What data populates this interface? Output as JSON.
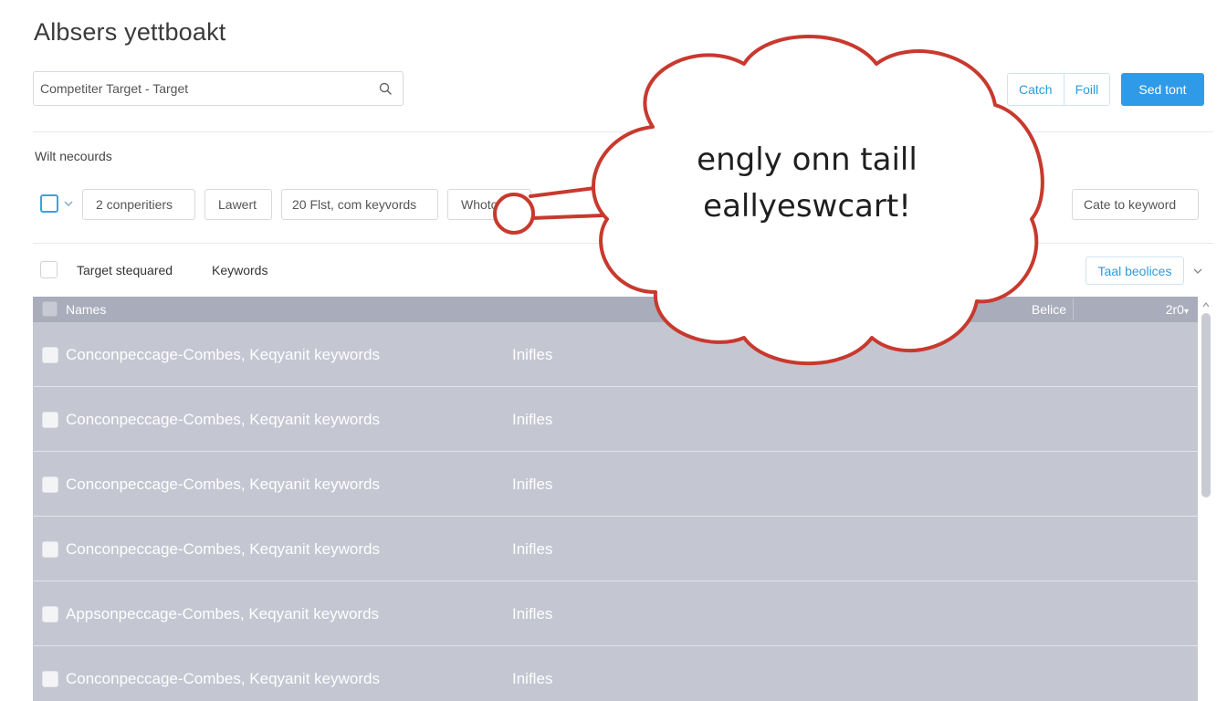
{
  "header": {
    "title": "Albsers yettboakt"
  },
  "search": {
    "value": "Competiter Target - Target",
    "icon": "search-icon"
  },
  "actions": {
    "catch_label": "Catch",
    "full_label": "Foill",
    "primary_label": "Sed tont"
  },
  "section": {
    "label": "Wilt necourds"
  },
  "filters": {
    "chips": [
      {
        "label": "2 conperitiers"
      },
      {
        "label": "Lawert"
      },
      {
        "label": "20 Flst, com keyvords"
      },
      {
        "label": "Whoto"
      }
    ],
    "right_chip": "Cate to keyword"
  },
  "subheader": {
    "label1": "Target stequared",
    "label2": "Keywords",
    "select_label": "Taal beolices"
  },
  "table": {
    "columns": {
      "name": "Names",
      "before": "Belice",
      "count": "2r0"
    },
    "rows": [
      {
        "name": "Conconpeccage-Combes, Keqyanit keywords",
        "type": "Inifles"
      },
      {
        "name": "Conconpeccage-Combes, Keqyanit keywords",
        "type": "Inifles"
      },
      {
        "name": "Conconpeccage-Combes, Keqyanit keywords",
        "type": "Inifles"
      },
      {
        "name": "Conconpeccage-Combes, Keqyanit keywords",
        "type": "Inifles"
      },
      {
        "name": "Appsonpeccage-Combes, Keqyanit keywords",
        "type": "Inifles"
      },
      {
        "name": "Conconpeccage-Combes, Keqyanit keywords",
        "type": "Inifles"
      }
    ]
  },
  "bubble": {
    "line1": "engly onn taill",
    "line2": "eallyeswcart!",
    "outline_color": "#c8392e"
  },
  "colors": {
    "accent": "#2f9be8",
    "table_bg": "#c4c6d2",
    "table_header": "#a9acbb"
  }
}
